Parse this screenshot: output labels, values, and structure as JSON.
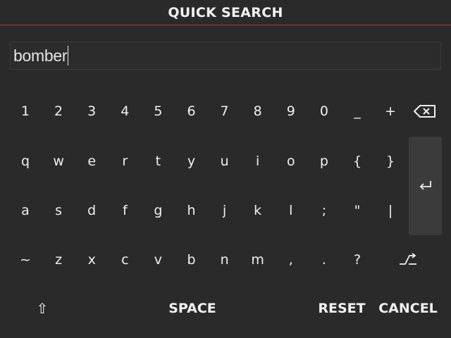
{
  "header": {
    "title": "QUICK SEARCH"
  },
  "search": {
    "value": "bomber"
  },
  "keyboard": {
    "row1": [
      "1",
      "2",
      "3",
      "4",
      "5",
      "6",
      "7",
      "8",
      "9",
      "0",
      "_",
      "+"
    ],
    "row2": [
      "q",
      "w",
      "e",
      "r",
      "t",
      "y",
      "u",
      "i",
      "o",
      "p",
      "{",
      "}"
    ],
    "row3": [
      "a",
      "s",
      "d",
      "f",
      "g",
      "h",
      "j",
      "k",
      "l",
      ";",
      "\"",
      "|"
    ],
    "row4": [
      "~",
      "z",
      "x",
      "c",
      "v",
      "b",
      "n",
      "m",
      ",",
      ".",
      "?"
    ]
  },
  "icons": {
    "backspace": "backspace-icon",
    "enter": "enter-icon",
    "shift": "shift-icon",
    "symbols": "symbols-toggle-icon"
  },
  "bottom": {
    "shift_glyph": "⇧",
    "space_label": "SPACE",
    "reset_label": "RESET",
    "cancel_label": "CANCEL"
  },
  "colors": {
    "background": "#2a2a2a",
    "accent_line": "#b03a3a",
    "enter_key_bg": "#3b3b3b"
  }
}
